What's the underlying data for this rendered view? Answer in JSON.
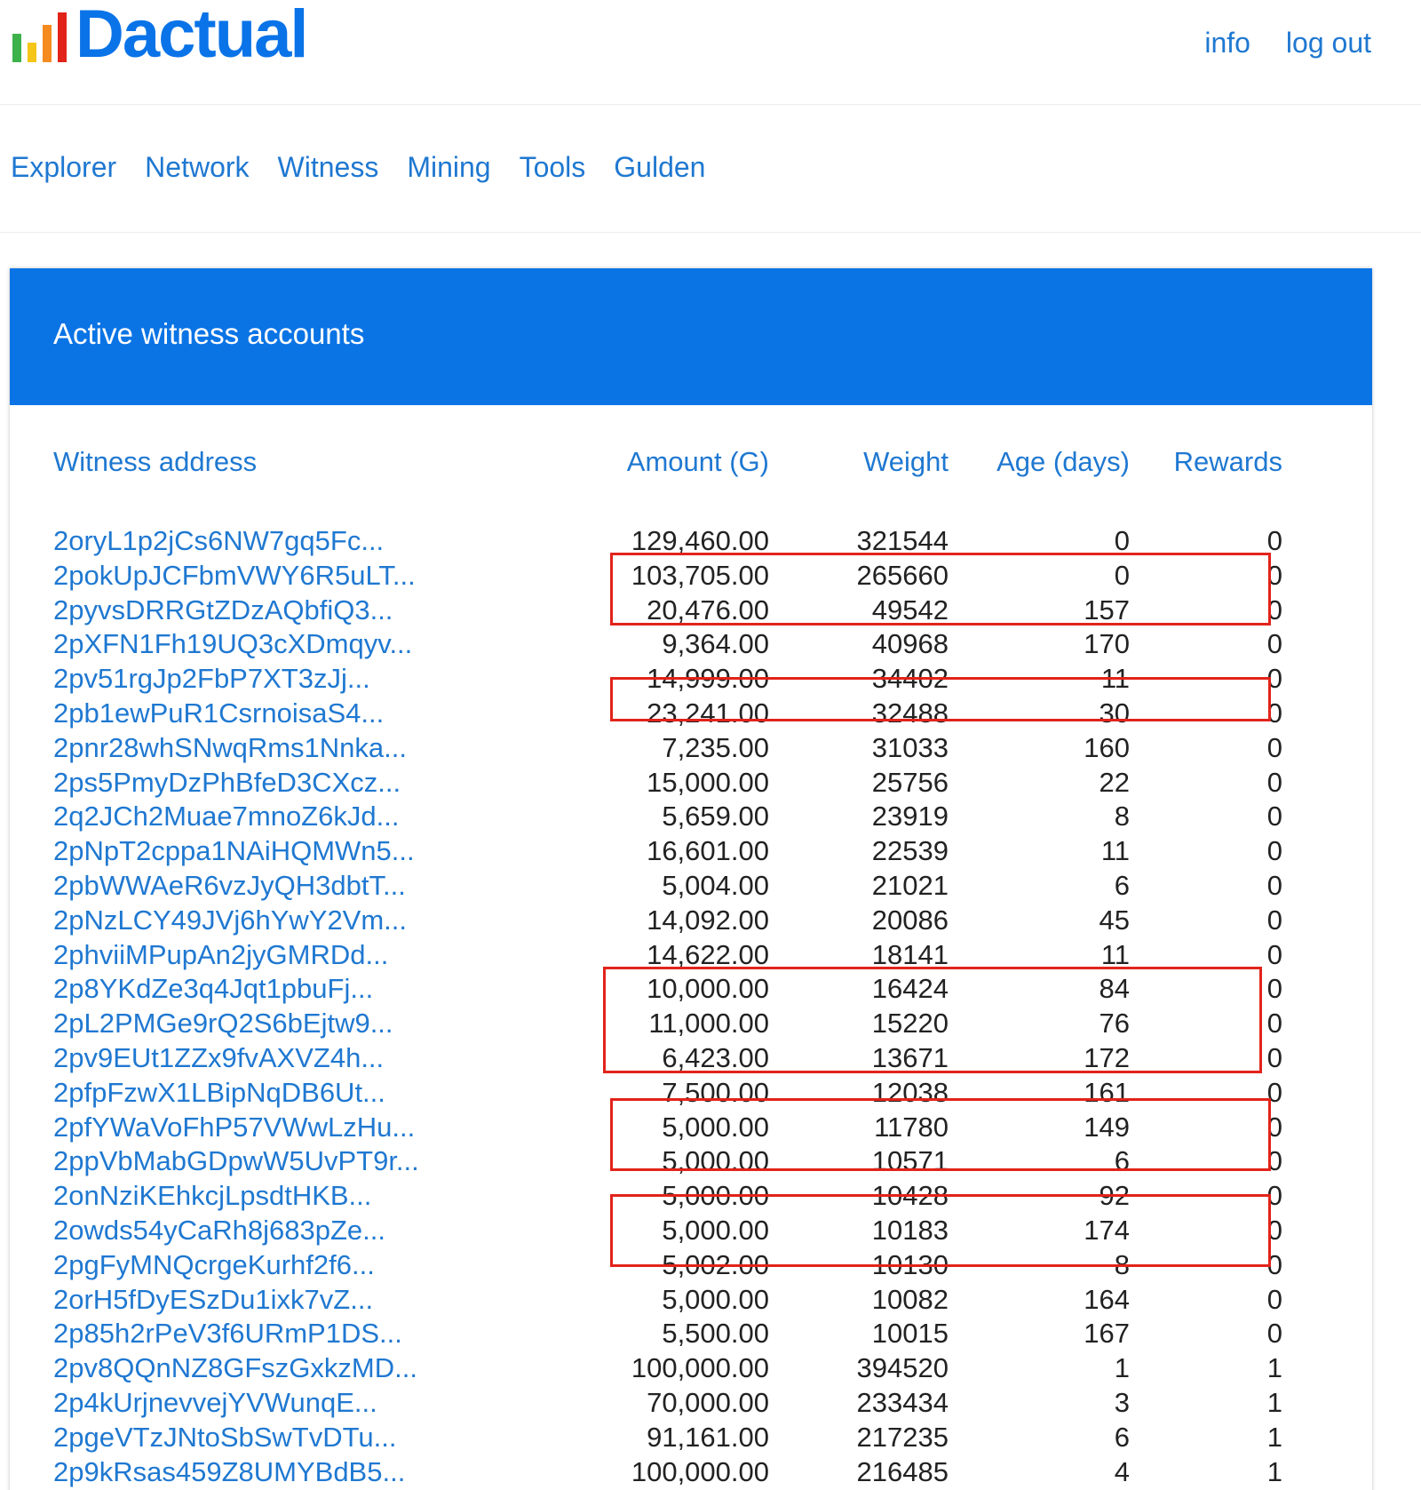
{
  "brand": {
    "name": "Dactual",
    "bar_colors": [
      "#3db24b",
      "#f5c518",
      "#f58a1f",
      "#e2231a"
    ]
  },
  "top_links": [
    {
      "label": "info"
    },
    {
      "label": "log out"
    }
  ],
  "nav": [
    {
      "label": "Explorer"
    },
    {
      "label": "Network"
    },
    {
      "label": "Witness"
    },
    {
      "label": "Mining"
    },
    {
      "label": "Tools"
    },
    {
      "label": "Gulden"
    }
  ],
  "card": {
    "title": "Active witness accounts",
    "header_color": "#0b74e5"
  },
  "table": {
    "columns": [
      "Witness address",
      "Amount (G)",
      "Weight",
      "Age (days)",
      "Rewards"
    ],
    "rows": [
      [
        "2oryL1p2jCs6NW7gq5Fc...",
        "129,460.00",
        "321544",
        "0",
        "0"
      ],
      [
        "2pokUpJCFbmVWY6R5uLT...",
        "103,705.00",
        "265660",
        "0",
        "0"
      ],
      [
        "2pyvsDRRGtZDzAQbfiQ3...",
        "20,476.00",
        "49542",
        "157",
        "0"
      ],
      [
        "2pXFN1Fh19UQ3cXDmqyv...",
        "9,364.00",
        "40968",
        "170",
        "0"
      ],
      [
        "2pv51rgJp2FbP7XT3zJj...",
        "14,999.00",
        "34402",
        "11",
        "0"
      ],
      [
        "2pb1ewPuR1CsrnoisaS4...",
        "23,241.00",
        "32488",
        "30",
        "0"
      ],
      [
        "2pnr28whSNwqRms1Nnka...",
        "7,235.00",
        "31033",
        "160",
        "0"
      ],
      [
        "2ps5PmyDzPhBfeD3CXcz...",
        "15,000.00",
        "25756",
        "22",
        "0"
      ],
      [
        "2q2JCh2Muae7mnoZ6kJd...",
        "5,659.00",
        "23919",
        "8",
        "0"
      ],
      [
        "2pNpT2cppa1NAiHQMWn5...",
        "16,601.00",
        "22539",
        "11",
        "0"
      ],
      [
        "2pbWWAeR6vzJyQH3dbtT...",
        "5,004.00",
        "21021",
        "6",
        "0"
      ],
      [
        "2pNzLCY49JVj6hYwY2Vm...",
        "14,092.00",
        "20086",
        "45",
        "0"
      ],
      [
        "2phviiMPupAn2jyGMRDd...",
        "14,622.00",
        "18141",
        "11",
        "0"
      ],
      [
        "2p8YKdZe3q4Jqt1pbuFj...",
        "10,000.00",
        "16424",
        "84",
        "0"
      ],
      [
        "2pL2PMGe9rQ2S6bEjtw9...",
        "11,000.00",
        "15220",
        "76",
        "0"
      ],
      [
        "2pv9EUt1ZZx9fvAXVZ4h...",
        "6,423.00",
        "13671",
        "172",
        "0"
      ],
      [
        "2pfpFzwX1LBipNqDB6Ut...",
        "7,500.00",
        "12038",
        "161",
        "0"
      ],
      [
        "2pfYWaVoFhP57VWwLzHu...",
        "5,000.00",
        "11780",
        "149",
        "0"
      ],
      [
        "2ppVbMabGDpwW5UvPT9r...",
        "5,000.00",
        "10571",
        "6",
        "0"
      ],
      [
        "2onNziKEhkcjLpsdtHKB...",
        "5,000.00",
        "10428",
        "92",
        "0"
      ],
      [
        "2owds54yCaRh8j683pZe...",
        "5,000.00",
        "10183",
        "174",
        "0"
      ],
      [
        "2pgFyMNQcrgeKurhf2f6...",
        "5,002.00",
        "10130",
        "8",
        "0"
      ],
      [
        "2orH5fDyESzDu1ixk7vZ...",
        "5,000.00",
        "10082",
        "164",
        "0"
      ],
      [
        "2p85h2rPeV3f6URmP1DS...",
        "5,500.00",
        "10015",
        "167",
        "0"
      ],
      [
        "2pv8QQnNZ8GFszGxkzMD...",
        "100,000.00",
        "394520",
        "1",
        "1"
      ],
      [
        "2p4kUrjnevvejYVWunqE...",
        "70,000.00",
        "233434",
        "3",
        "1"
      ],
      [
        "2pgeVTzJNtoSbSwTvDTu...",
        "91,161.00",
        "217235",
        "6",
        "1"
      ],
      [
        "2p9kRsas459Z8UMYBdB5...",
        "100,000.00",
        "216485",
        "4",
        "1"
      ]
    ]
  },
  "highlight_color": "#e2231a"
}
